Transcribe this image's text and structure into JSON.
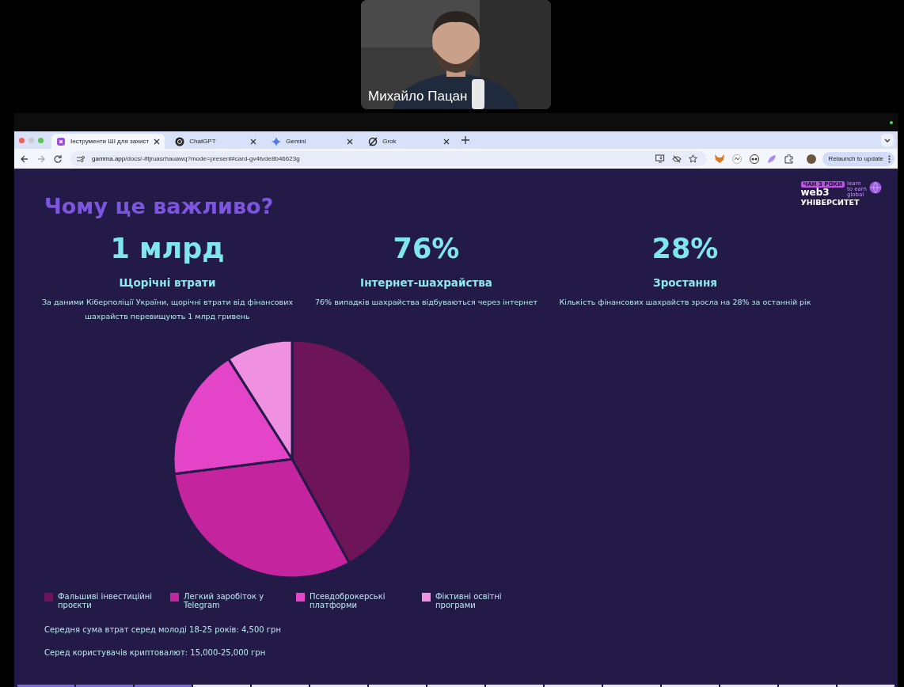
{
  "video_tile": {
    "kind": "picture",
    "name": "Михайло Пацан"
  },
  "browser": {
    "tabs": [
      {
        "title": "Інструменти ШІ для захист",
        "selected": true
      },
      {
        "title": "ChatGPT",
        "selected": false
      },
      {
        "title": "Gemini",
        "selected": false
      },
      {
        "title": "Grok",
        "selected": false
      }
    ],
    "url_host": "gamma.app",
    "url_path": "/docs/-iftjruasrhauawq?mode=present#card-gv4tvde8b46623g",
    "update_button": "Relaunch to update"
  },
  "slide": {
    "title": "Чому це важливо?",
    "logo": {
      "badge": "ЧАН З РОКИ",
      "brand": "web3",
      "name": "УНІВЕРСИТЕТ",
      "tagline": [
        "learn",
        "to earn",
        "global"
      ]
    },
    "stats": [
      {
        "value": "1 млрд",
        "label": "Щорічні втрати",
        "text": "За даними Кіберполіції України, щорічні втрати від фінансових шахрайств перевищують 1 млрд гривень"
      },
      {
        "value": "76%",
        "label": "Інтернет-шахрайства",
        "text": "76% випадків шахрайства відбуваються через інтернет"
      },
      {
        "value": "28%",
        "label": "Зростання",
        "text": "Кількість фінансових шахрайств зросла на 28% за останній рік"
      }
    ],
    "legend": [
      {
        "label": "Фальшиві інвестиційні проєкти",
        "color": "#6e1458"
      },
      {
        "label": "Легкий заробіток у Telegram",
        "color": "#c4259e"
      },
      {
        "label": "Псевдоброкерські платформи",
        "color": "#e444c8"
      },
      {
        "label": "Фіктивні освітні програми",
        "color": "#f090e0"
      }
    ],
    "notes": [
      "Середня сума втрат серед молоді 18-25 років: 4,500 грн",
      "Серед користувачів криптовалют: 15,000-25,000 грн"
    ]
  }
}
